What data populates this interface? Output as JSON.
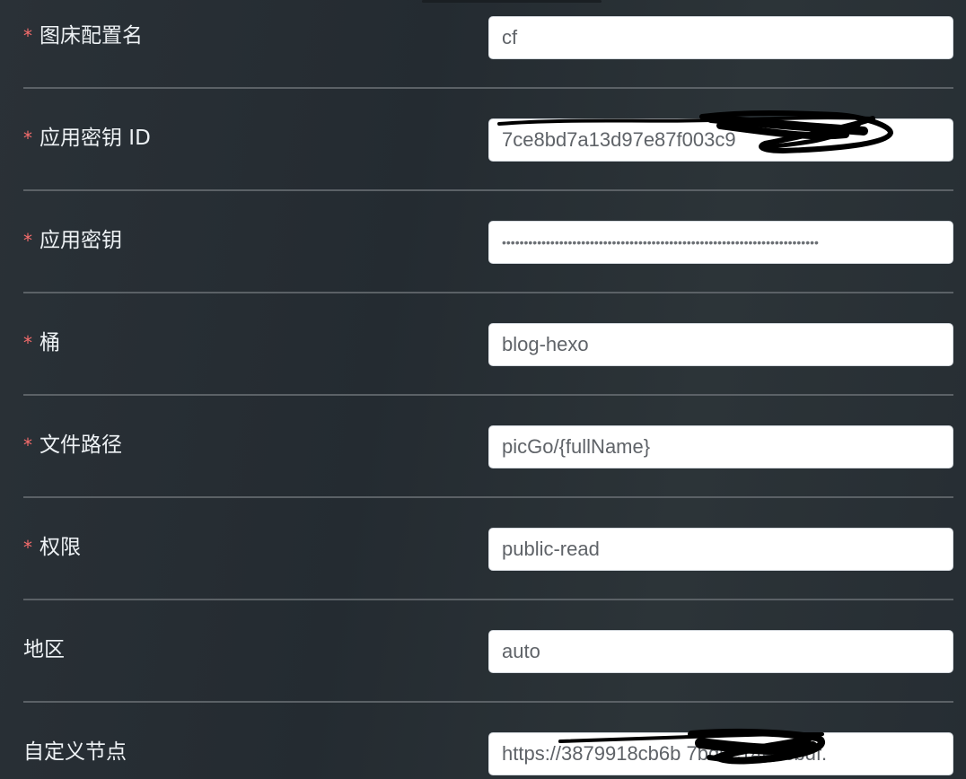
{
  "form": {
    "fields": [
      {
        "label": "图床配置名",
        "required": true,
        "value": "cf",
        "type": "text"
      },
      {
        "label": "应用密钥 ID",
        "required": true,
        "value": "7ce8bd7a13d97e87f003c9",
        "type": "text",
        "redacted": true
      },
      {
        "label": "应用密钥",
        "required": true,
        "value": "••••••••••••••••••••••••••••••••••••••••••••••••••••••••••••••••••••••••",
        "type": "password"
      },
      {
        "label": "桶",
        "required": true,
        "value": "blog-hexo",
        "type": "text"
      },
      {
        "label": "文件路径",
        "required": true,
        "value": "picGo/{fullName}",
        "type": "text"
      },
      {
        "label": "权限",
        "required": true,
        "value": "public-read",
        "type": "text"
      },
      {
        "label": "地区",
        "required": false,
        "value": "auto",
        "type": "text"
      },
      {
        "label": "自定义节点",
        "required": false,
        "value": "https://3879918cb6b              7bd6c14eecbdf.",
        "type": "text",
        "redacted": true
      }
    ],
    "required_marker": "*"
  },
  "colors": {
    "background": "#262d33",
    "label_text": "#eef2f5",
    "required_marker": "#f56c6c",
    "input_background": "#ffffff",
    "input_text": "#5f6368",
    "divider": "#5b6166",
    "redaction_ink": "#000000"
  }
}
